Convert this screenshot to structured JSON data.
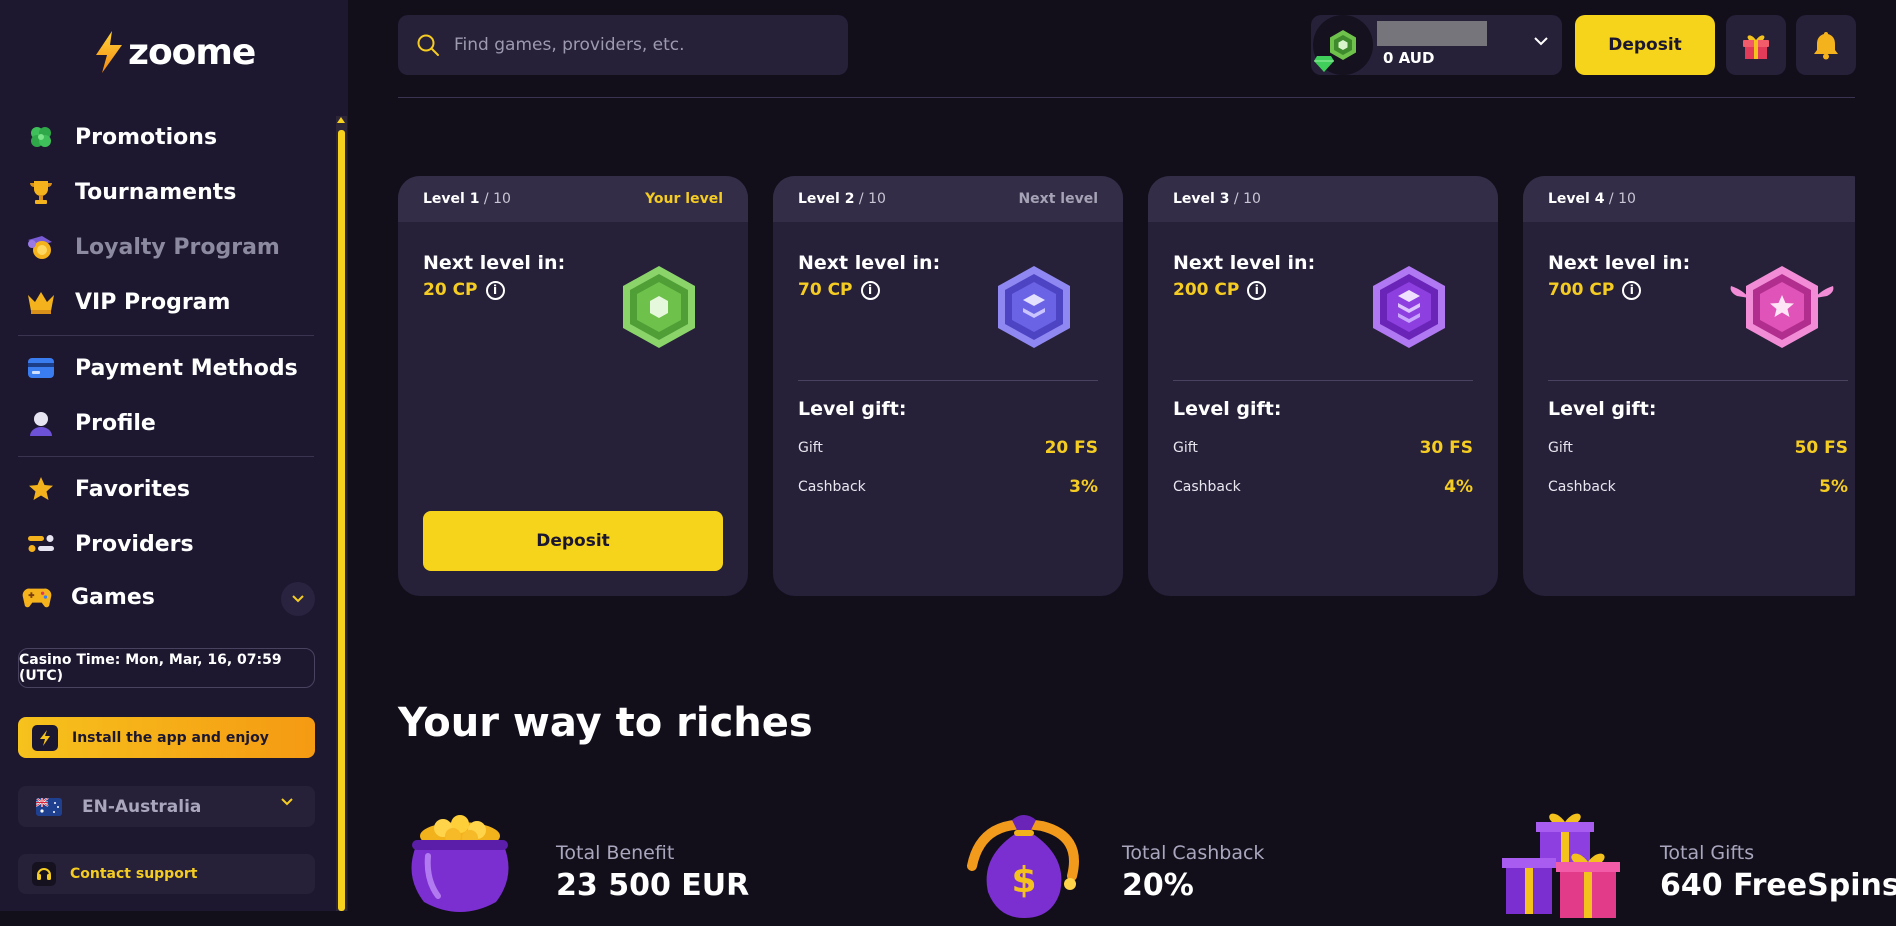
{
  "brand": {
    "name": "zoome"
  },
  "sidebar": {
    "items": [
      {
        "label": "Promotions",
        "icon": "clover-icon"
      },
      {
        "label": "Tournaments",
        "icon": "trophy-icon"
      },
      {
        "label": "Loyalty Program",
        "icon": "coin-cart-icon",
        "active": true
      },
      {
        "label": "VIP Program",
        "icon": "crown-icon"
      },
      {
        "label": "Payment Methods",
        "icon": "card-icon"
      },
      {
        "label": "Profile",
        "icon": "user-icon"
      },
      {
        "label": "Favorites",
        "icon": "star-icon"
      },
      {
        "label": "Providers",
        "icon": "providers-icon"
      },
      {
        "label": "Games",
        "icon": "gamepad-icon"
      }
    ],
    "casino_time": "Casino Time: Mon, Mar, 16, 07:59 (UTC)",
    "install_app": "Install the app and enjoy",
    "language": "EN-Australia",
    "contact_support": "Contact support"
  },
  "header": {
    "search_placeholder": "Find games, providers, etc.",
    "balance": "0 AUD",
    "deposit_label": "Deposit"
  },
  "levels": [
    {
      "label": "Level 1",
      "total": "/ 10",
      "tag": "Your level",
      "next_level_label": "Next level in:",
      "cp": "20 CP",
      "badge_color": "#6ec14b",
      "deposit_label": "Deposit"
    },
    {
      "label": "Level 2",
      "total": "/ 10",
      "tag": "Next level",
      "next_level_label": "Next level in:",
      "cp": "70 CP",
      "badge_color": "#6b63e6",
      "gift_title": "Level gift:",
      "gift_label": "Gift",
      "gift_value": "20 FS",
      "cashback_label": "Cashback",
      "cashback_value": "3%"
    },
    {
      "label": "Level 3",
      "total": "/ 10",
      "tag": "",
      "next_level_label": "Next level in:",
      "cp": "200 CP",
      "badge_color": "#8d3fe0",
      "gift_title": "Level gift:",
      "gift_label": "Gift",
      "gift_value": "30 FS",
      "cashback_label": "Cashback",
      "cashback_value": "4%"
    },
    {
      "label": "Level 4",
      "total": "/ 10",
      "tag": "",
      "next_level_label": "Next level in:",
      "cp": "700 CP",
      "badge_color": "#e053b8",
      "gift_title": "Level gift:",
      "gift_label": "Gift",
      "gift_value": "50 FS",
      "cashback_label": "Cashback",
      "cashback_value": "5%"
    }
  ],
  "riches": {
    "title": "Your way to riches",
    "stats": [
      {
        "label": "Total Benefit",
        "value": "23 500 EUR",
        "art": "gold-pot-icon"
      },
      {
        "label": "Total Cashback",
        "value": "20%",
        "art": "money-bag-icon"
      },
      {
        "label": "Total Gifts",
        "value": "640 FreeSpins",
        "art": "gift-boxes-icon"
      }
    ]
  },
  "colors": {
    "accent": "#f7d41c",
    "background": "#120f1b",
    "sidebar": "#1d1730",
    "card": "#262039"
  }
}
